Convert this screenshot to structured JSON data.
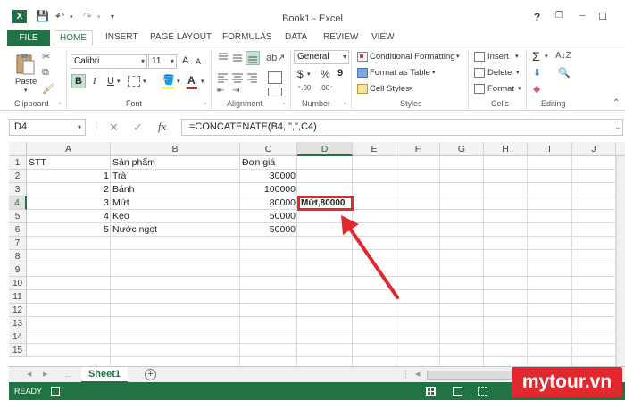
{
  "titlebar": {
    "title": "Book1 - Excel",
    "logo": "X",
    "help": "?",
    "min": "─",
    "restore": "❐",
    "close": "✕"
  },
  "tabs": {
    "file": "FILE",
    "home": "HOME",
    "insert": "INSERT",
    "page_layout": "PAGE LAYOUT",
    "formulas": "FORMULAS",
    "data": "DATA",
    "review": "REVIEW",
    "view": "VIEW"
  },
  "ribbon": {
    "paste": "Paste",
    "font_name": "Calibri",
    "font_size": "11",
    "bold": "B",
    "italic": "I",
    "underline": "U",
    "grow": "A",
    "shrink": "A",
    "font_color": "A",
    "number_format": "General",
    "currency": "$",
    "percent": "%",
    "comma": "9",
    "conditional": "Conditional Formatting",
    "format_table": "Format as Table",
    "cell_styles": "Cell Styles",
    "insert": "Insert",
    "delete": "Delete",
    "format": "Format",
    "sum": "Σ",
    "groups": {
      "clipboard": "Clipboard",
      "font": "Font",
      "alignment": "Alignment",
      "number": "Number",
      "styles": "Styles",
      "cells": "Cells",
      "editing": "Editing"
    }
  },
  "formula_bar": {
    "name_box": "D4",
    "cancel": "✕",
    "enter": "✓",
    "fx": "fx",
    "formula": "=CONCATENATE(B4, \",\",C4)"
  },
  "columns": [
    "A",
    "B",
    "C",
    "D",
    "E",
    "F",
    "G",
    "H",
    "I",
    "J"
  ],
  "rows": [
    "1",
    "2",
    "3",
    "4",
    "5",
    "6",
    "7",
    "8",
    "9",
    "10",
    "11",
    "12",
    "13",
    "14",
    "15"
  ],
  "cells": {
    "A1": "STT",
    "B1": "Sản phẩm",
    "C1": "Đơn giá",
    "A2": "1",
    "B2": "Trà",
    "C2": "30000",
    "A3": "2",
    "B3": "Bánh",
    "C3": "100000",
    "A4": "3",
    "B4": "Mứt",
    "C4": "80000",
    "D4": "Mứt,80000",
    "A5": "4",
    "B5": "Kẹo",
    "C5": "50000",
    "A6": "5",
    "B6": "Nước ngọt",
    "C6": "50000"
  },
  "sheet": {
    "tab": "Sheet1",
    "add": "+",
    "prev": "◀",
    "next": "▶",
    "dots": "..."
  },
  "status": {
    "ready": "READY"
  },
  "watermark": "mytour.vn",
  "colors": {
    "excel_green": "#217346",
    "highlight": "#e0282e"
  }
}
